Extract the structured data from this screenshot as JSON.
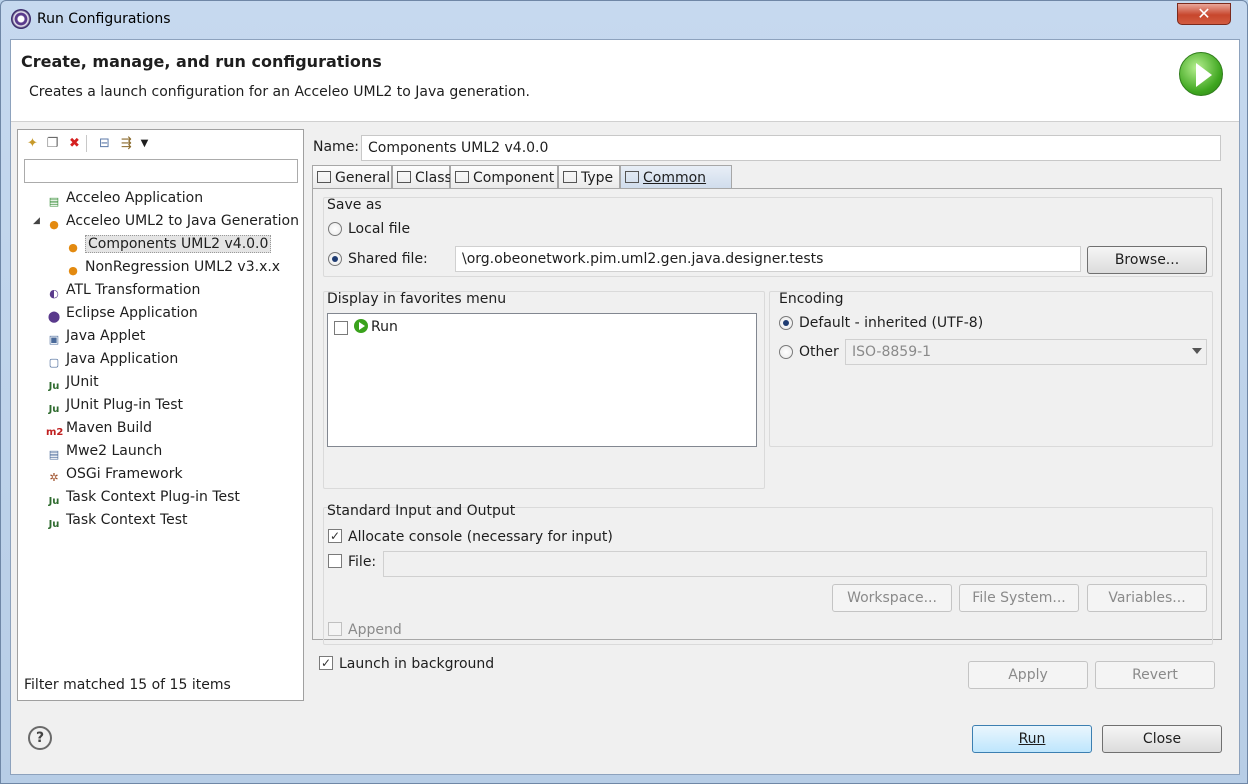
{
  "window": {
    "title": "Run Configurations",
    "close_glyph": "✕"
  },
  "header": {
    "title": "Create, manage, and run configurations",
    "description": "Creates a launch configuration for an Acceleo UML2 to Java generation."
  },
  "left": {
    "filter_placeholder": "",
    "tree": [
      {
        "label": "Acceleo Application",
        "icon": "acceleo-app-icon",
        "level": 0
      },
      {
        "label": "Acceleo UML2 to Java Generation",
        "icon": "acceleo-uml2-icon",
        "level": 0,
        "expanded": true
      },
      {
        "label": "Components UML2 v4.0.0",
        "icon": "acceleo-config-icon",
        "level": 1,
        "selected": true
      },
      {
        "label": "NonRegression UML2 v3.x.x",
        "icon": "acceleo-config-icon",
        "level": 1
      },
      {
        "label": "ATL Transformation",
        "icon": "atl-icon",
        "level": 0
      },
      {
        "label": "Eclipse Application",
        "icon": "eclipse-icon",
        "level": 0
      },
      {
        "label": "Java Applet",
        "icon": "java-applet-icon",
        "level": 0
      },
      {
        "label": "Java Application",
        "icon": "java-app-icon",
        "level": 0
      },
      {
        "label": "JUnit",
        "icon": "junit-icon",
        "level": 0
      },
      {
        "label": "JUnit Plug-in Test",
        "icon": "junit-plugin-icon",
        "level": 0
      },
      {
        "label": "Maven Build",
        "icon": "maven-icon",
        "level": 0
      },
      {
        "label": "Mwe2 Launch",
        "icon": "mwe2-icon",
        "level": 0
      },
      {
        "label": "OSGi Framework",
        "icon": "osgi-icon",
        "level": 0
      },
      {
        "label": "Task Context Plug-in Test",
        "icon": "task-context-plugin-icon",
        "level": 0
      },
      {
        "label": "Task Context Test",
        "icon": "task-context-icon",
        "level": 0
      }
    ],
    "filter_status": "Filter matched 15 of 15 items"
  },
  "config": {
    "name_label": "Name:",
    "name_value": "Components UML2 v4.0.0",
    "tabs": [
      "General",
      "Class",
      "Component",
      "Type",
      "Common"
    ],
    "active_tab": "Common",
    "save_as": {
      "title": "Save as",
      "local_label": "Local file",
      "shared_label": "Shared file:",
      "shared_value": "\\org.obeonetwork.pim.uml2.gen.java.designer.tests",
      "browse_label": "Browse...",
      "selected": "shared"
    },
    "favorites": {
      "title": "Display in favorites menu",
      "items": [
        {
          "label": "Run",
          "checked": false
        }
      ]
    },
    "encoding": {
      "title": "Encoding",
      "default_label": "Default - inherited (UTF-8)",
      "other_label": "Other",
      "other_value": "ISO-8859-1",
      "selected": "default"
    },
    "stdio": {
      "title": "Standard Input and Output",
      "allocate_label": "Allocate console (necessary for input)",
      "allocate_checked": true,
      "file_label": "File:",
      "file_value": "",
      "file_checked": false,
      "workspace_label": "Workspace...",
      "filesystem_label": "File System...",
      "variables_label": "Variables...",
      "append_label": "Append",
      "append_checked": false
    },
    "launch_bg_label": "Launch in background",
    "launch_bg_checked": true,
    "apply_label": "Apply",
    "revert_label": "Revert"
  },
  "footer": {
    "run_label": "Run",
    "close_label": "Close",
    "help_glyph": "?"
  },
  "colors": {
    "run_green": "#3aa21c",
    "titlebar": "#c6d9ef",
    "close_red": "#c7472d"
  }
}
